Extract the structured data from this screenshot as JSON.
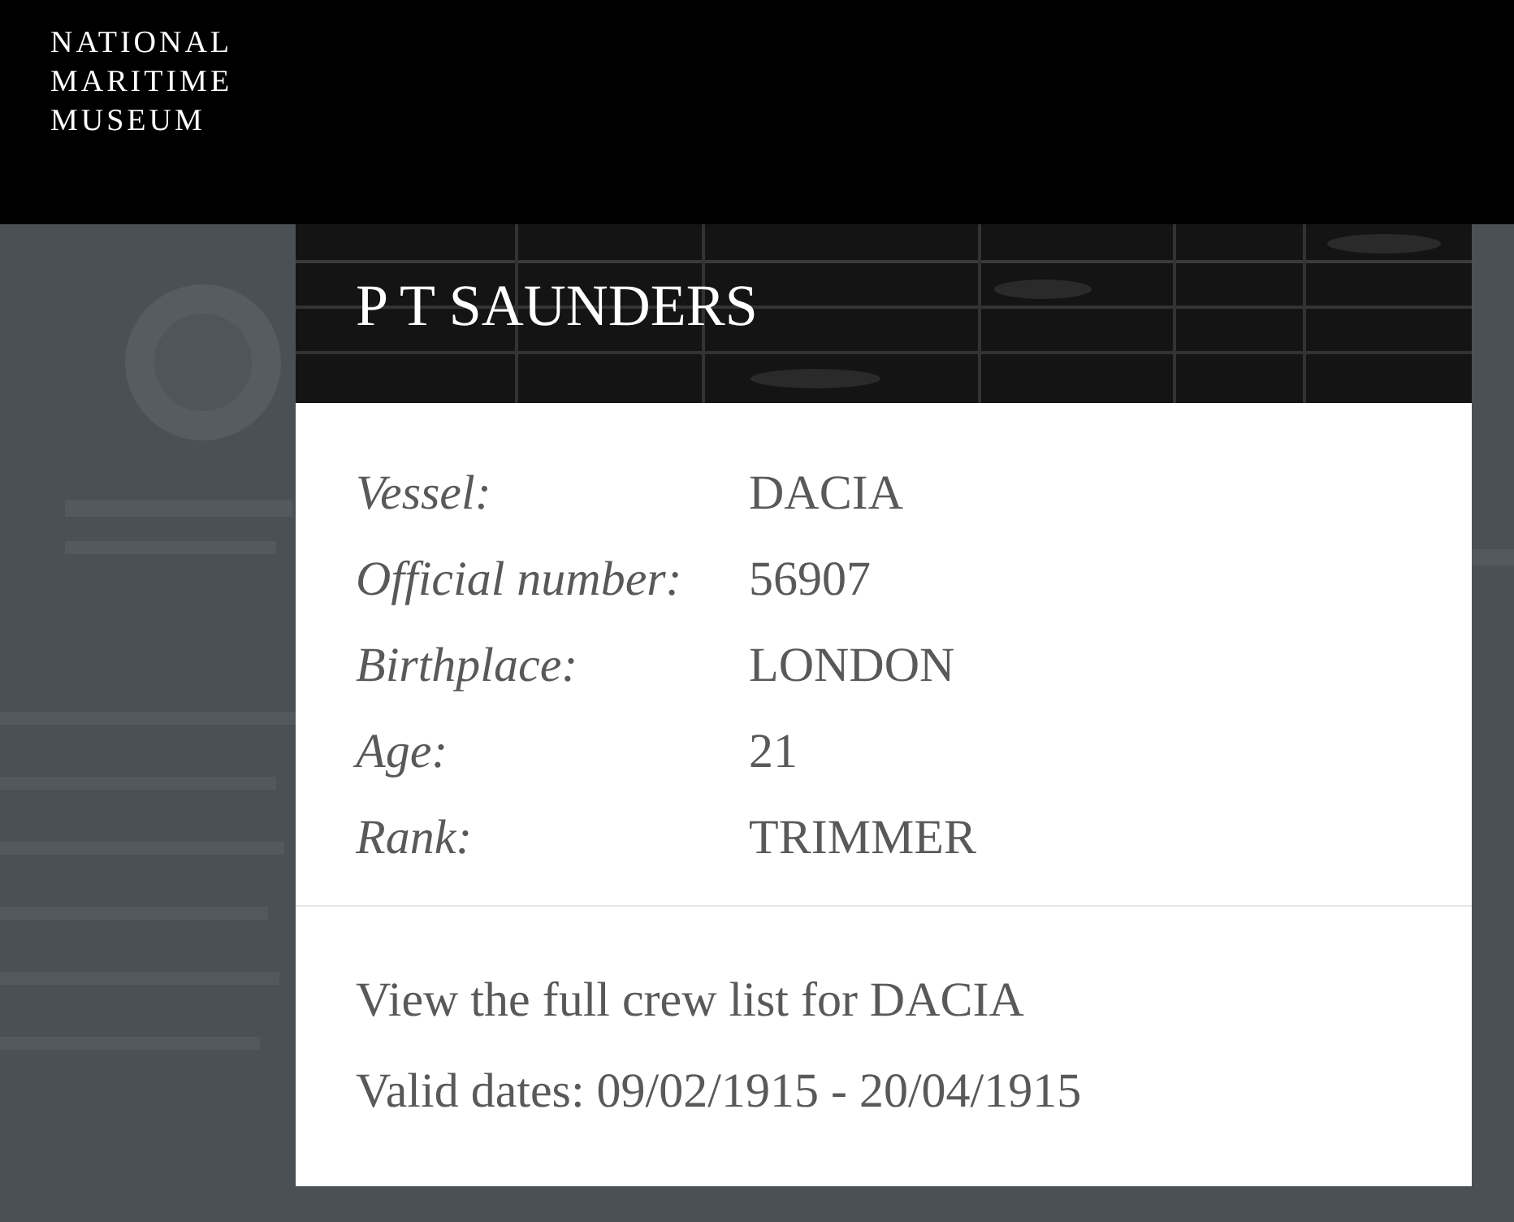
{
  "header": {
    "logo_lines": [
      "NATIONAL",
      "MARITIME",
      "MUSEUM"
    ]
  },
  "record": {
    "title": "P T SAUNDERS",
    "fields": [
      {
        "label": "Vessel:",
        "value": "DACIA"
      },
      {
        "label": "Official number:",
        "value": "56907"
      },
      {
        "label": "Birthplace:",
        "value": "LONDON"
      },
      {
        "label": "Age:",
        "value": "21"
      },
      {
        "label": "Rank:",
        "value": "TRIMMER"
      }
    ],
    "crew_list_link": "View the full crew list for DACIA",
    "valid_dates": "Valid dates: 09/02/1915 - 20/04/1915"
  }
}
